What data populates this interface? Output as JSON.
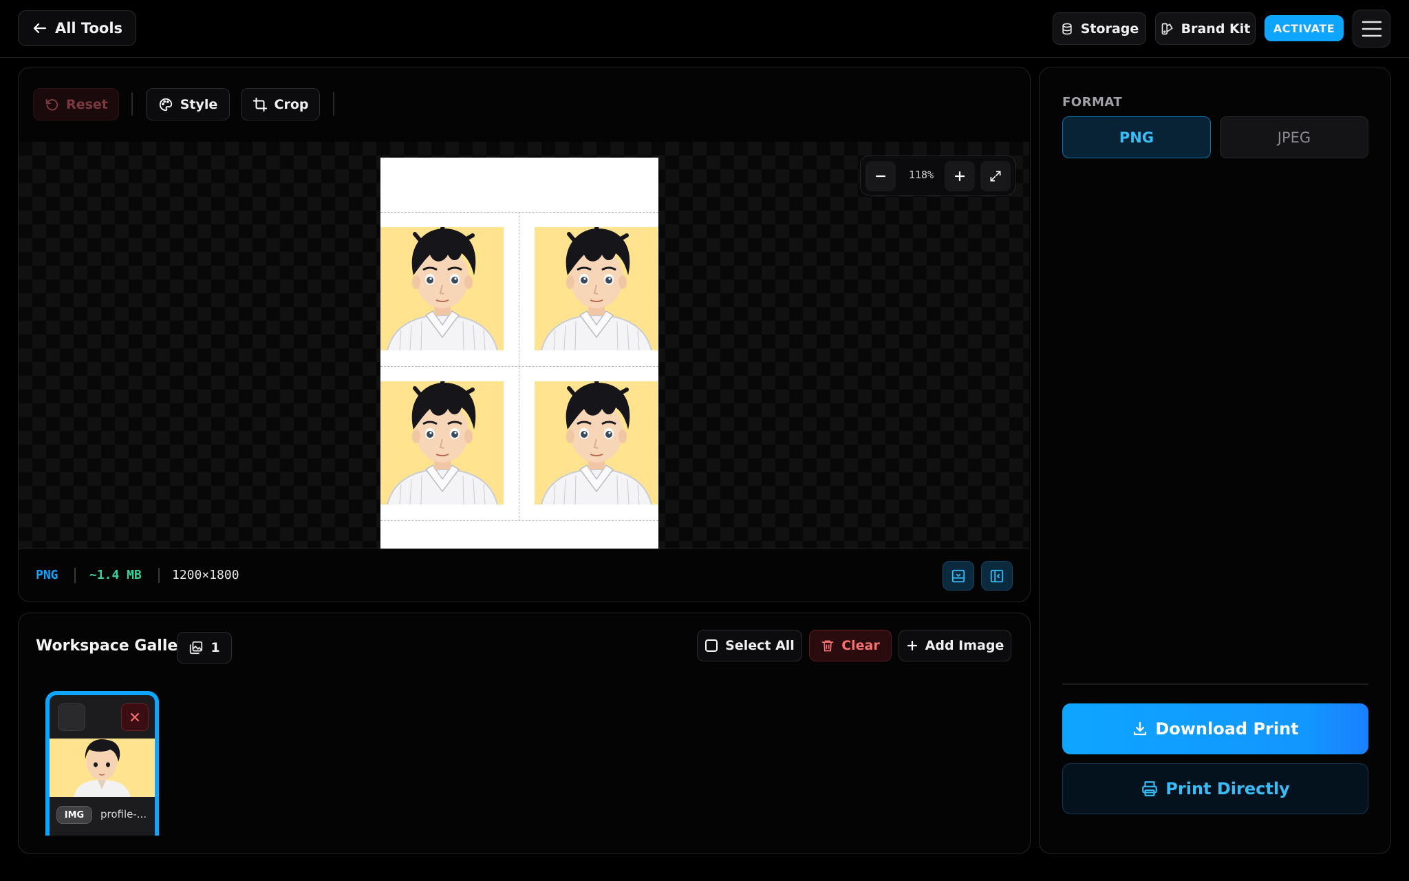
{
  "header": {
    "back_label": "All Tools",
    "storage_label": "Storage",
    "brandkit_label": "Brand Kit",
    "activate_label": "ACTIVATE"
  },
  "toolbar": {
    "reset_label": "Reset",
    "style_label": "Style",
    "crop_label": "Crop"
  },
  "zoom": {
    "level": "118%"
  },
  "status": {
    "format": "PNG",
    "size": "~1.4 MB",
    "dimensions": "1200×1800"
  },
  "gallery": {
    "title": "Workspace Gallery",
    "count": "1",
    "select_all_label": "Select All",
    "clear_label": "Clear",
    "add_label": "Add Image",
    "items": [
      {
        "badge": "IMG",
        "name": "profile-..."
      }
    ]
  },
  "side": {
    "format_heading": "FORMAT",
    "formats": [
      "PNG",
      "JPEG"
    ],
    "selected_format": "PNG",
    "download_label": "Download Print",
    "print_label": "Print Directly"
  },
  "colors": {
    "accent": "#0ea5ff",
    "size_green": "#34d399",
    "danger": "#ef4444"
  }
}
